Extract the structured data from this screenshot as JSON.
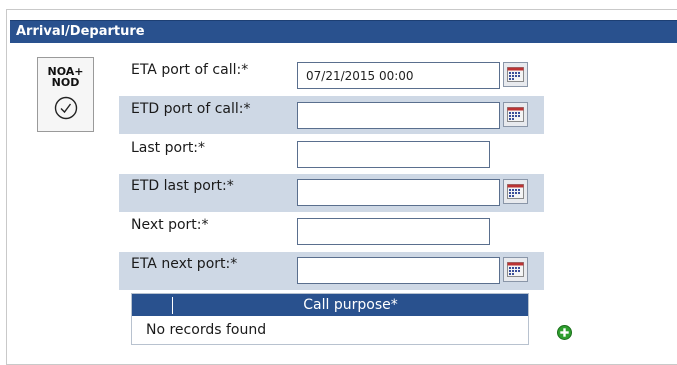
{
  "section": {
    "title": "Arrival/Departure"
  },
  "badge": {
    "line1": "NOA+",
    "line2": "NOD",
    "icon": "clock-icon"
  },
  "fields": [
    {
      "label": "ETA port of call:*",
      "value": "07/21/2015 00:00",
      "has_calendar": true
    },
    {
      "label": "ETD port of call:*",
      "value": "",
      "has_calendar": true
    },
    {
      "label": "Last port:*",
      "value": "",
      "has_calendar": false
    },
    {
      "label": "ETD last port:*",
      "value": "",
      "has_calendar": true
    },
    {
      "label": "Next port:*",
      "value": "",
      "has_calendar": false
    },
    {
      "label": "ETA next port:*",
      "value": "",
      "has_calendar": true
    }
  ],
  "call_purpose_grid": {
    "column_header": "Call purpose*",
    "empty_text": "No records found"
  },
  "colors": {
    "header": "#29518e",
    "row_shade": "#ced8e5",
    "add_icon": "#2e9e2e"
  }
}
